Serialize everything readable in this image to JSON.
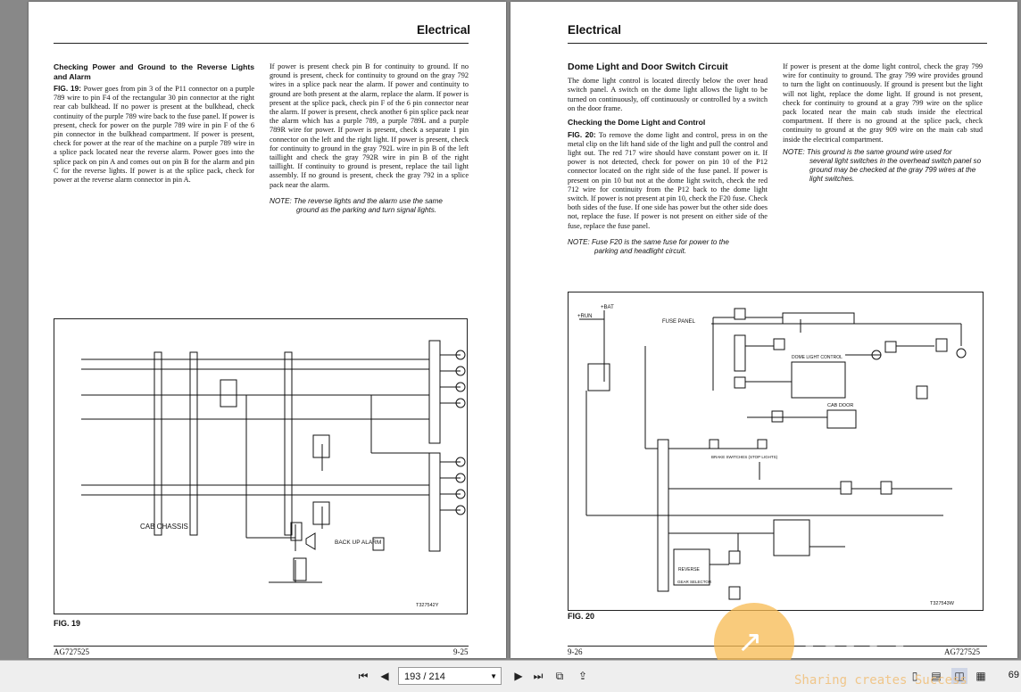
{
  "left_page": {
    "header": "Electrical",
    "heading": "Checking Power and Ground to the Reverse Lights and Alarm",
    "col1_figref": "FIG. 19:",
    "col1_text": "Power goes from pin 3 of the P11 connector on a purple 789 wire to pin F4 of the rectangular 30 pin connector at the right rear cab bulkhead. If no power is present at the bulkhead, check continuity of the purple 789 wire back to the fuse panel. If power is present, check for power on the purple 789 wire in pin F of the 6 pin connector in the bulkhead compartment. If power is present, check for power at the rear of the machine on a purple 789 wire in a splice pack located near the reverse alarm. Power goes into the splice pack on pin A and comes out on pin B for the alarm and pin C for the reverse lights. If power is at the splice pack, check for power at the reverse alarm connector in pin A.",
    "col2_text": "If power is present check pin B for continuity to ground. If no ground is present, check for continuity to ground on the gray 792 wires in a splice pack near the alarm. If power and continuity to ground are both present at the alarm, replace the alarm. If power is present at the splice pack, check pin F of the 6 pin connector near the alarm. If power is present, check another 6 pin splice pack near the alarm which has a purple 789, a purple 789L and a purple 789R wire for power. If power is present, check a separate 1 pin connector on the left and the right light. If power is present, check for continuity to ground in the gray 792L wire in pin B of the left taillight and check the gray 792R wire in pin B of the right taillight. If continuity to ground is present, replace the tail light assembly. If no ground is present, check the gray 792 in a splice pack near the alarm.",
    "note_line1": "NOTE: The reverse lights and the alarm use the same",
    "note_line2": "ground as the parking and turn signal lights.",
    "diagram_label_cab": "CAB  CHASSIS",
    "diagram_label_alarm": "BACK UP ALARM",
    "diagram_code": "T327542Y",
    "fig_label": "FIG. 19",
    "footer_left": "AG727525",
    "footer_right": "9-25"
  },
  "right_page": {
    "header": "Electrical",
    "heading": "Dome Light and Door Switch Circuit",
    "col1_text": "The dome light control is located directly below the over head switch panel. A switch on the dome light allows the light to be turned on continuously, off continuously or controlled by a switch on the door frame.",
    "subheading": "Checking the Dome Light and Control",
    "col1_figref": "FIG. 20:",
    "col1_text2": "To remove the dome light and control, press in on the metal clip on the lift hand side of the light and pull the control and light out. The red 717 wire should have constant power on it. If power is not detected, check for power on pin 10 of the P12 connector located on the right side of the fuse panel. If power is present on pin 10 but not at the dome light switch, check the red 712 wire for continuity from the P12 back to the dome light switch. If power is not present at pin 10, check the F20 fuse. Check both sides of the fuse. If one side has power but the other side does not, replace the fuse. If power is not present on either side of the fuse, replace the fuse panel.",
    "note1_line1": "NOTE: Fuse F20 is the same fuse for power to the",
    "note1_line2": "parking and headlight circuit.",
    "col2_text": "If power is present at the dome light control, check the gray 799 wire for continuity to ground. The gray 799 wire provides ground to turn the light on continuously. If ground is present but the light will not light, replace the dome light. If ground is not present, check for continuity to ground at a gray 799 wire on the splice pack located near the main cab studs inside the electrical compartment. If there is no ground at the splice pack, check continuity to ground at the gray 909 wire on the main cab stud inside the electrical compartment.",
    "note2_line1": "NOTE: This ground is the same ground wire used for",
    "note2_line2": "several light switches in the overhead switch panel so ground may be checked at the gray 799 wires at the light switches.",
    "diagram_label_fuse": "FUSE PANEL",
    "diagram_label_bat": "+BAT",
    "diagram_label_run": "+RUN",
    "diagram_label_dome": "DOME LIGHT CONTROL",
    "diagram_label_door": "CAB DOOR",
    "diagram_label_brake": "BRAKE SWITCHES (STOP LIGHTS)",
    "diagram_label_gear": "GEAR SELECTOR",
    "diagram_label_reverse": "REVERSE",
    "diagram_code": "T327543W",
    "fig_label": "FIG. 20",
    "footer_left": "9-26",
    "footer_right": "AG727525"
  },
  "toolbar": {
    "page_indicator": "193 / 214",
    "zoom": "69"
  },
  "watermark": {
    "logo_text": "DHT",
    "tagline": "Sharing creates Success"
  }
}
